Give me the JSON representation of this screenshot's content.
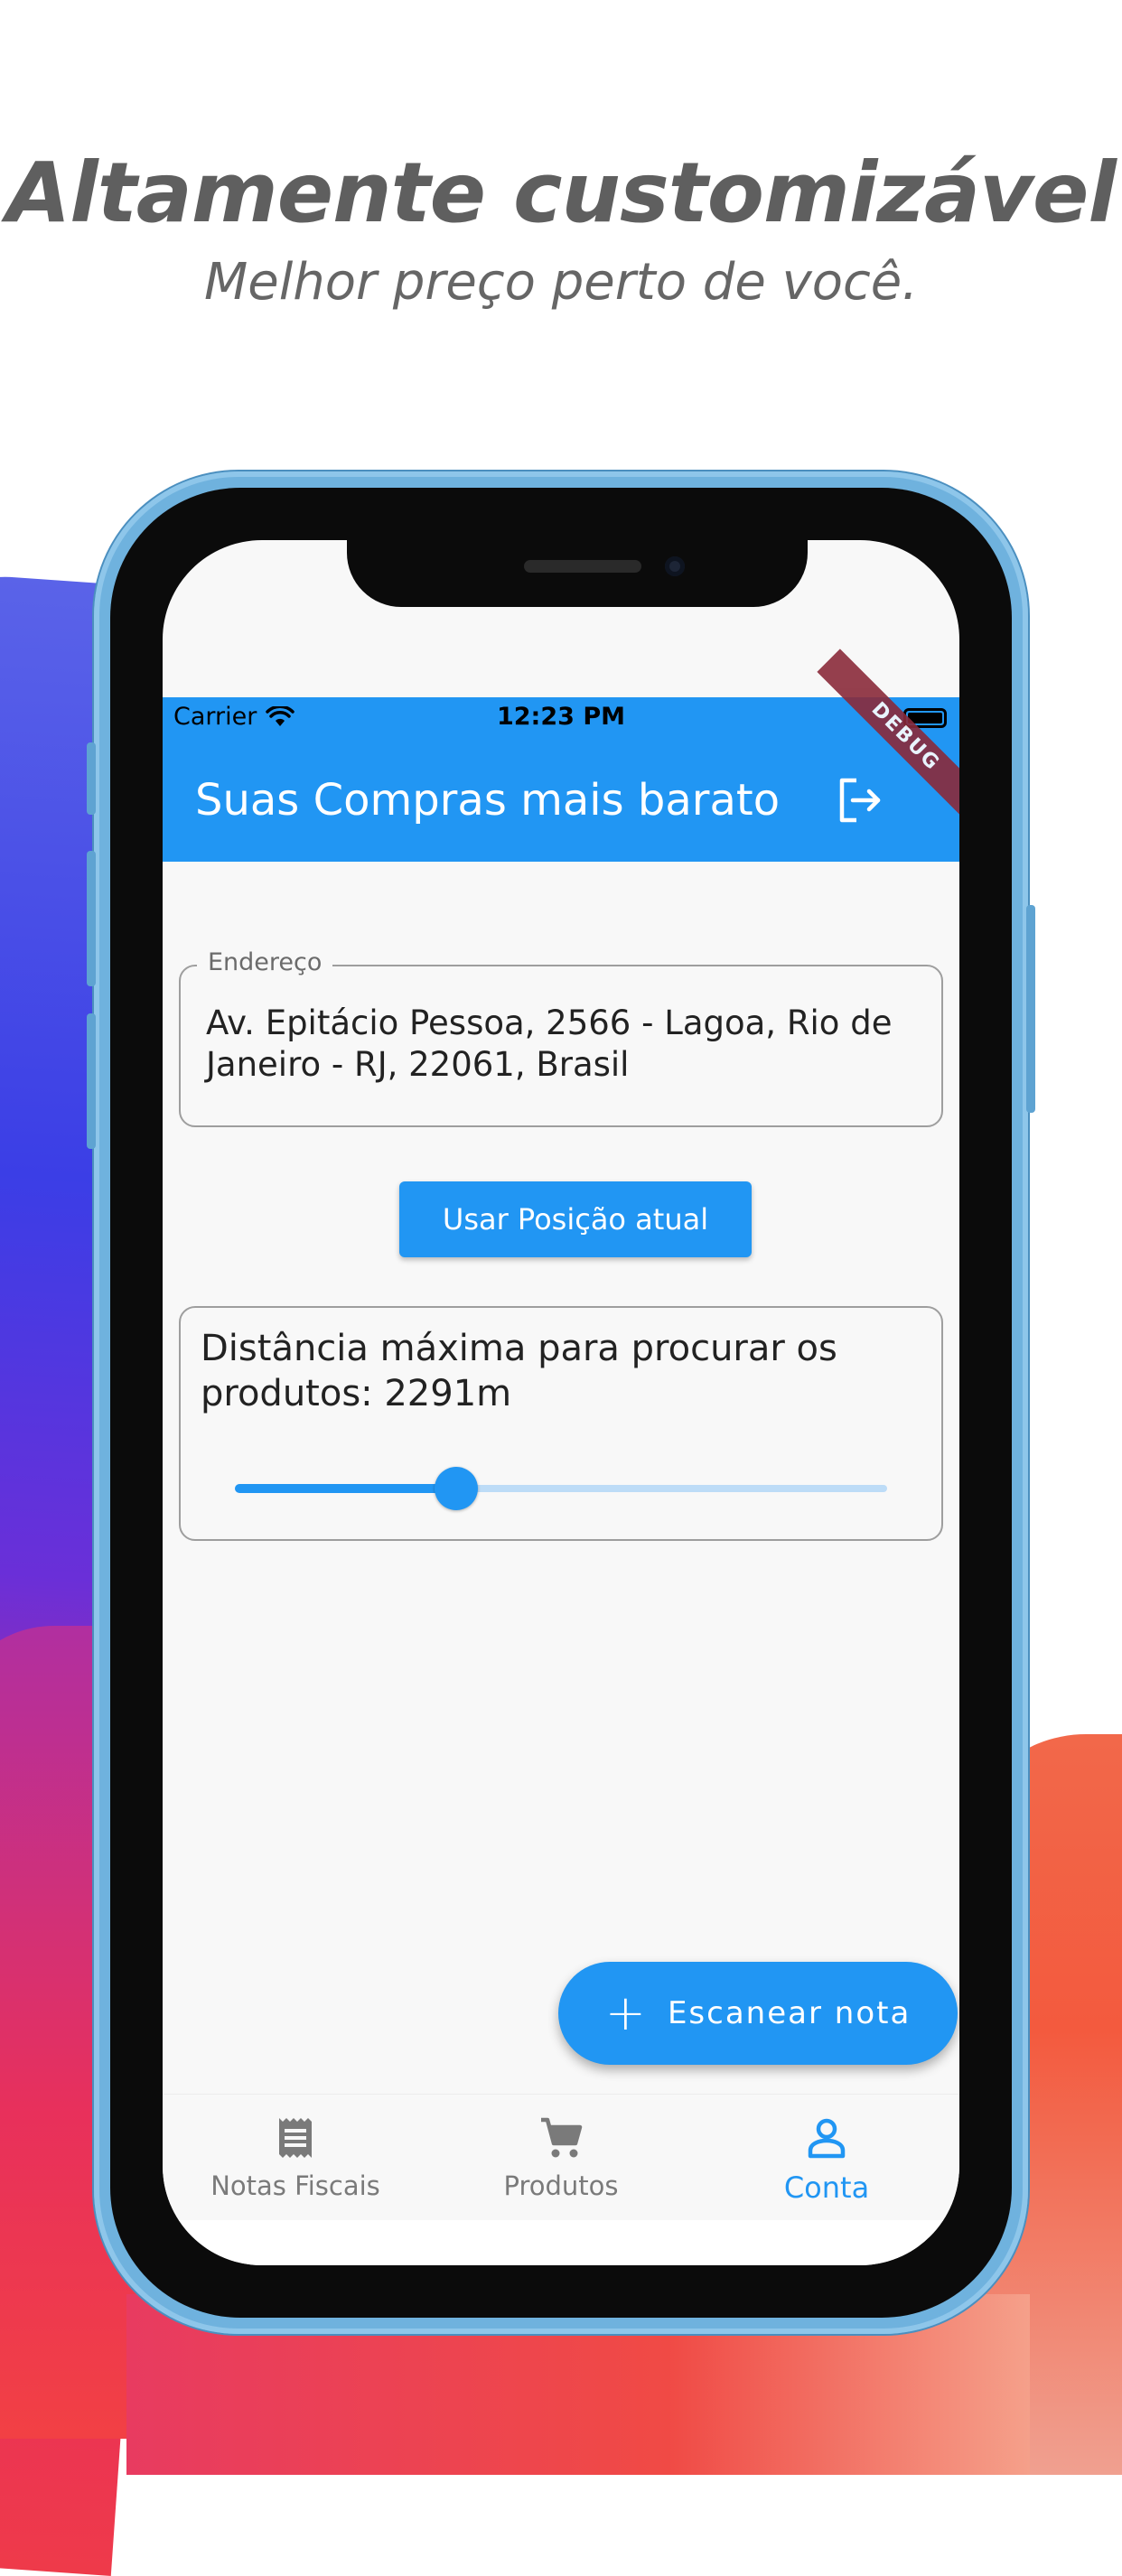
{
  "promo": {
    "title": "Altamente customizável",
    "subtitle": "Melhor preço perto de você."
  },
  "status_bar": {
    "carrier": "Carrier",
    "time": "12:23 PM",
    "wifi_icon": "wifi-icon",
    "battery_icon": "battery-icon"
  },
  "app_bar": {
    "title": "Suas Compras mais barato",
    "logout_icon": "logout-icon",
    "debug_banner": "DEBUG",
    "color": "#2196f3"
  },
  "address": {
    "label": "Endereço",
    "value": "Av. Epitácio Pessoa, 2566 - Lagoa, Rio de Janeiro - RJ, 22061, Brasil"
  },
  "location_button": {
    "label": "Usar Posição atual"
  },
  "distance": {
    "text": "Distância máxima para procurar os produtos: 2291m",
    "slider_fraction": 0.34
  },
  "fab": {
    "icon": "plus-icon",
    "label": "Escanear nota"
  },
  "bottom_nav": {
    "items": [
      {
        "label": "Notas Fiscais",
        "icon": "receipt-icon",
        "active": false
      },
      {
        "label": "Produtos",
        "icon": "shopping-cart-icon",
        "active": false
      },
      {
        "label": "Conta",
        "icon": "person-icon",
        "active": true
      }
    ]
  }
}
